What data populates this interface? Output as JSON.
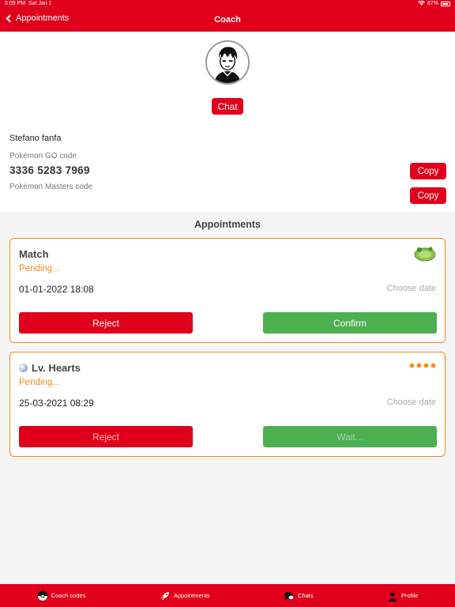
{
  "status_bar": {
    "time": "5:09 PM",
    "date": "Sat Jan 1",
    "battery": "87%"
  },
  "nav": {
    "back_label": "Appointments",
    "title": "Coach"
  },
  "profile": {
    "chat_label": "Chat",
    "name": "Stefano fanfa",
    "go_code_label": "Pokémon GO code",
    "go_code": "3336 5283 7969",
    "masters_code_label": "Pokémon Masters code",
    "copy_label": "Copy"
  },
  "appointments": {
    "title": "Appointments",
    "items": [
      {
        "title": "Match",
        "status": "Pending...",
        "datetime": "01-01-2022 18:08",
        "choose_date": "Choose date",
        "reject_label": "Reject",
        "confirm_label": "Confirm"
      },
      {
        "title": "Lv. Hearts",
        "status": "Pending...",
        "datetime": "25-03-2021 08:29",
        "choose_date": "Choose date",
        "reject_label": "Reject",
        "confirm_label": "Wait..."
      }
    ]
  },
  "tabs": [
    {
      "label": "Coach codes",
      "icon": "pokeball-icon"
    },
    {
      "label": "Appointments",
      "icon": "rocket-icon"
    },
    {
      "label": "Chats",
      "icon": "chat-bubbles-icon"
    },
    {
      "label": "Profile",
      "icon": "profile-icon"
    }
  ],
  "colors": {
    "brand_red": "#e0001b",
    "accent_orange": "#f08a1c",
    "confirm_green": "#4caf50"
  }
}
